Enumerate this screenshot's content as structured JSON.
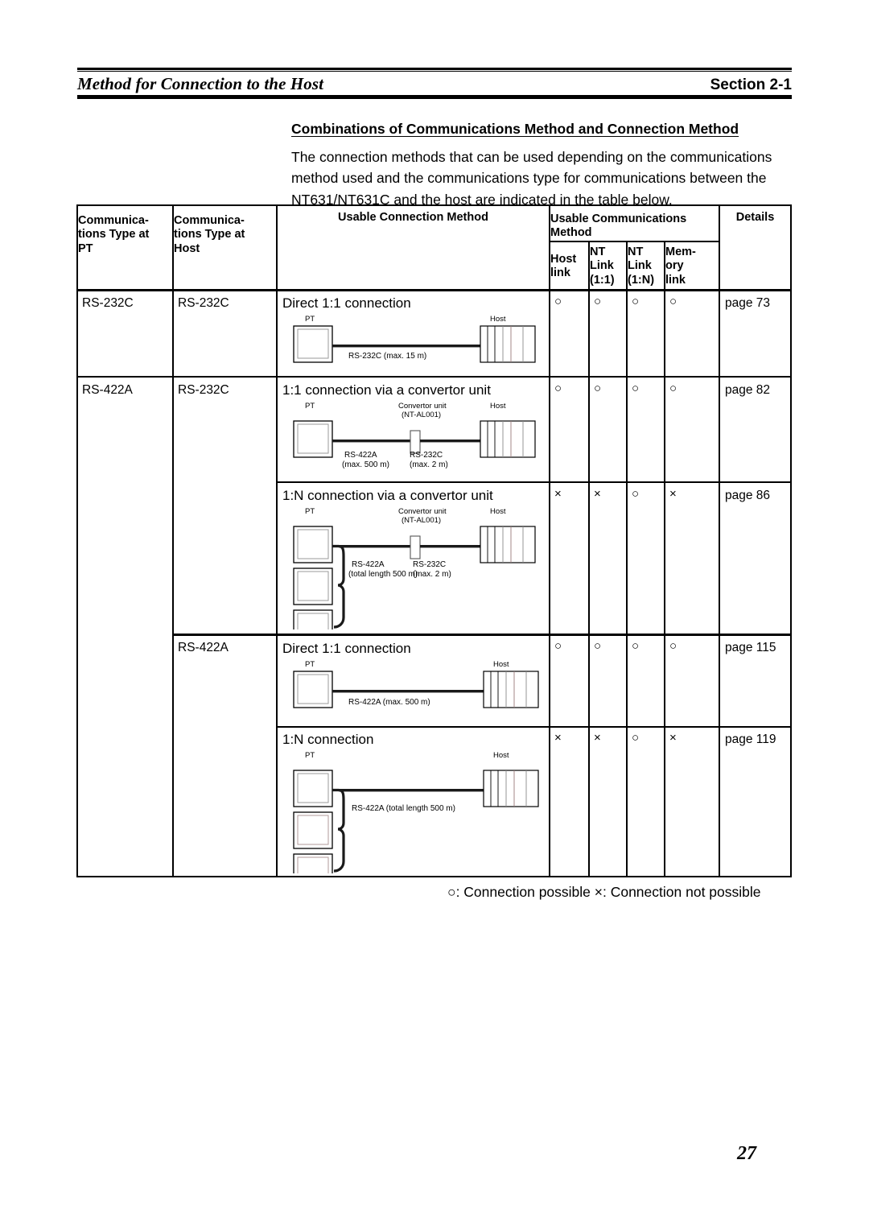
{
  "header": {
    "running_title": "Method for Connection to the Host",
    "section_label": "Section 2-1"
  },
  "intro": {
    "title": "Combinations of Communications Method and Connection Method",
    "body": "The connection methods that can be used depending on the communications method used and the communications type for communications between the NT631/NT631C and the host are indicated in the table below."
  },
  "table": {
    "headers": {
      "col1_line1": "Communica-",
      "col1_line2": "tions Type at",
      "col1_line3": "PT",
      "col2_line1": "Communica-",
      "col2_line2": "tions Type at",
      "col2_line3": "Host",
      "col3": "Usable Connection Method",
      "col4_group_line1": "Usable Communications",
      "col4_group_line2": "Method",
      "sub_host_line1": "Host",
      "sub_host_line2": "link",
      "sub_nt11_line1": "NT",
      "sub_nt11_line2": "Link",
      "sub_nt11_line3": "(1:1)",
      "sub_nt1n_line1": "NT",
      "sub_nt1n_line2": "Link",
      "sub_nt1n_line3": "(1:N)",
      "sub_mem_line1": "Mem-",
      "sub_mem_line2": "ory",
      "sub_mem_line3": "link",
      "col5": "Details"
    },
    "rows": [
      {
        "pt_type": "RS-232C",
        "host_type": "RS-232C",
        "connection_title": "Direct 1:1 connection",
        "host_link": "○",
        "nt_link_11": "○",
        "nt_link_1n": "○",
        "memory_link": "○",
        "details": "page 73",
        "diagram": {
          "pt_label": "PT",
          "host_label": "Host",
          "cable_label": "RS-232C (max. 15 m)"
        }
      },
      {
        "pt_type": "RS-422A",
        "host_type": "RS-232C",
        "connection_title": "1:1 connection via a convertor unit",
        "host_link": "○",
        "nt_link_11": "○",
        "nt_link_1n": "○",
        "memory_link": "○",
        "details": "page 82",
        "diagram": {
          "pt_label": "PT",
          "host_label": "Host",
          "convertor_line1": "Convertor unit",
          "convertor_line2": "(NT-AL001)",
          "cable_left_line1": "RS-422A",
          "cable_left_line2": "(max. 500 m)",
          "cable_right_line1": "RS-232C",
          "cable_right_line2": "(max. 2 m)"
        }
      },
      {
        "pt_type": "",
        "host_type": "",
        "connection_title": "1:N connection via a convertor unit",
        "host_link": "×",
        "nt_link_11": "×",
        "nt_link_1n": "○",
        "memory_link": "×",
        "details": "page 86",
        "diagram": {
          "pt_label": "PT",
          "host_label": "Host",
          "convertor_line1": "Convertor unit",
          "convertor_line2": "(NT-AL001)",
          "cable_left_line1": "RS-422A",
          "cable_left_line2": "(total length 500 m)",
          "cable_right_line1": "RS-232C",
          "cable_right_line2": "(max. 2 m)"
        }
      },
      {
        "pt_type": "",
        "host_type": "RS-422A",
        "connection_title": "Direct 1:1 connection",
        "host_link": "○",
        "nt_link_11": "○",
        "nt_link_1n": "○",
        "memory_link": "○",
        "details": "page 115",
        "diagram": {
          "pt_label": "PT",
          "host_label": "Host",
          "cable_label": "RS-422A (max. 500 m)"
        }
      },
      {
        "pt_type": "",
        "host_type": "",
        "connection_title": "1:N connection",
        "host_link": "×",
        "nt_link_11": "×",
        "nt_link_1n": "○",
        "memory_link": "×",
        "details": "page 119",
        "diagram": {
          "pt_label": "PT",
          "host_label": "Host",
          "cable_label": "RS-422A (total length 500 m)"
        }
      }
    ]
  },
  "legend": "○: Connection possible  ×: Connection not possible",
  "folio": "27"
}
